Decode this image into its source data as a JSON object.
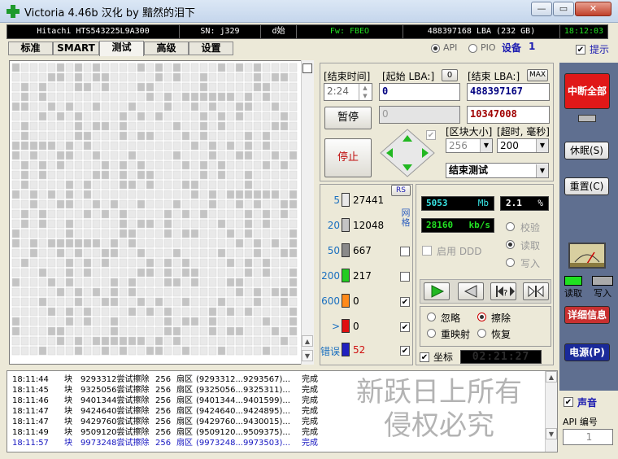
{
  "window": {
    "title": "Victoria 4.46b 汉化 by 黯然的泪下",
    "btn_minimize": "—",
    "btn_restore": "▭",
    "btn_close": "✕"
  },
  "infobar": {
    "model": "Hitachi HTS543225L9A300",
    "serial": "SN: j329",
    "serial_tail": "d始",
    "firmware": "Fw: FBEO",
    "capacity": "488397168 LBA  (232 GB)",
    "clock": "18:12:03"
  },
  "tabs": [
    "标准",
    "SMART",
    "测试",
    "高级",
    "设置"
  ],
  "mode": {
    "api": "API",
    "pio": "PIO",
    "device_label": "设备",
    "device_num": "1",
    "hint_label": "提示"
  },
  "test": {
    "end_time_label": "[结束时间]",
    "end_time_value": "2:24",
    "start_lba_label": "[起始 LBA:]",
    "start_lba_btn": "0",
    "start_lba_value": "0",
    "end_lba_label": "[结束 LBA:]",
    "end_lba_btn": "MAX",
    "end_lba_value": "488397167",
    "pause_label": "暂停",
    "progress_field": "0",
    "current_lba": "10347008",
    "stop_label": "停止",
    "block_size_label": "[区块大小]",
    "block_size_value": "256",
    "timeout_label": "[超时, 毫秒]",
    "timeout_value": "200",
    "end_action": "结束测试"
  },
  "legend": {
    "rs_label": "RS",
    "grid_label": "网格",
    "items": [
      {
        "threshold": "5",
        "count": "27441",
        "color": "#e9e9e9",
        "threshold_color": "#1a6fbf",
        "checked": false
      },
      {
        "threshold": "20",
        "count": "12048",
        "color": "#c4c4c4",
        "threshold_color": "#1a6fbf",
        "checked": false
      },
      {
        "threshold": "50",
        "count": "667",
        "color": "#8a8a8a",
        "threshold_color": "#1a6fbf",
        "checked": false
      },
      {
        "threshold": "200",
        "count": "217",
        "color": "#22cc22",
        "threshold_color": "#1a6fbf",
        "checked": false
      },
      {
        "threshold": "600",
        "count": "0",
        "color": "#ff8a1a",
        "threshold_color": "#1a6fbf",
        "checked": true
      },
      {
        "threshold": ">",
        "count": "0",
        "color": "#e01010",
        "threshold_color": "#1a6fbf",
        "checked": true
      },
      {
        "threshold": "错误",
        "count": "52",
        "color": "#2020c0",
        "threshold_color": "#1a6fbf",
        "checked": true
      }
    ],
    "check_mark": "✔",
    "error_count_color": "#d01010"
  },
  "stats": {
    "mb_value": "5053",
    "mb_unit": "Mb",
    "pct_value": "2.1",
    "pct_unit": "%",
    "speed_value": "28160",
    "speed_unit": "kb/s",
    "ddd_label": "启用 DDD",
    "verify": "校验",
    "read": "读取",
    "write": "写入"
  },
  "actions": {
    "ignore": "忽略",
    "erase": "擦除",
    "remap": "重映射",
    "restore": "恢复",
    "coords_label": "坐标",
    "coords_value": "02:21:27"
  },
  "log": [
    {
      "time": "18:11:44",
      "type": "块",
      "msg": "9293312尝试擦除",
      "size": "256",
      "area": "扇区",
      "range": "(9293312...9293567)...",
      "result": "完成",
      "highlight": false
    },
    {
      "time": "18:11:45",
      "type": "块",
      "msg": "9325056尝试擦除",
      "size": "256",
      "area": "扇区",
      "range": "(9325056...9325311)...",
      "result": "完成",
      "highlight": false
    },
    {
      "time": "18:11:46",
      "type": "块",
      "msg": "9401344尝试擦除",
      "size": "256",
      "area": "扇区",
      "range": "(9401344...9401599)...",
      "result": "完成",
      "highlight": false
    },
    {
      "time": "18:11:47",
      "type": "块",
      "msg": "9424640尝试擦除",
      "size": "256",
      "area": "扇区",
      "range": "(9424640...9424895)...",
      "result": "完成",
      "highlight": false
    },
    {
      "time": "18:11:47",
      "type": "块",
      "msg": "9429760尝试擦除",
      "size": "256",
      "area": "扇区",
      "range": "(9429760...9430015)...",
      "result": "完成",
      "highlight": false
    },
    {
      "time": "18:11:49",
      "type": "块",
      "msg": "9509120尝试擦除",
      "size": "256",
      "area": "扇区",
      "range": "(9509120...9509375)...",
      "result": "完成",
      "highlight": false
    },
    {
      "time": "18:11:57",
      "type": "块",
      "msg": "9973248尝试擦除",
      "size": "256",
      "area": "扇区",
      "range": "(9973248...9973503)...",
      "result": "完成",
      "highlight": true
    }
  ],
  "watermark": [
    "新跃日上所有",
    "侵权必究"
  ],
  "right": {
    "break_all": "中断全部",
    "sleep": "休眠(S)",
    "reset": "重置(C)",
    "read_lbl": "读取",
    "write_lbl": "写入",
    "details": "详细信息",
    "power": "电源(P)",
    "sound": "声音",
    "api_num_label": "API 编号",
    "api_num_value": "1"
  },
  "colors": {
    "lcd_cyan": "#39e6e6",
    "lcd_green": "#22e022",
    "lcd_white": "#ffffff",
    "lba_red": "#a00000",
    "lba_blue": "#000080",
    "log_highlight": "#1515c0",
    "arrow_green": "#22b822",
    "break_red": "#e01818"
  }
}
